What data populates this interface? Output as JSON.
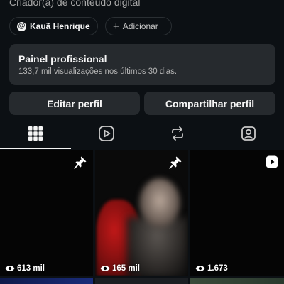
{
  "profile": {
    "category": "Criador(a) de conteúdo digital",
    "threads_chip": "Kauã Henrique",
    "add_chip": "Adicionar"
  },
  "professional_panel": {
    "title": "Painel profissional",
    "subtitle": "133,7 mil visualizações nos últimos 30 dias."
  },
  "actions": {
    "edit": "Editar perfil",
    "share": "Compartilhar perfil"
  },
  "tabs": [
    {
      "icon": "grid-icon",
      "active": true
    },
    {
      "icon": "reels-icon",
      "active": false
    },
    {
      "icon": "reposts-icon",
      "active": false
    },
    {
      "icon": "tagged-icon",
      "active": false
    }
  ],
  "posts": [
    {
      "views": "613 mil",
      "badge": "pin-icon"
    },
    {
      "views": "165 mil",
      "badge": "pin-icon"
    },
    {
      "views": "1.673",
      "badge": "reel-icon"
    }
  ]
}
